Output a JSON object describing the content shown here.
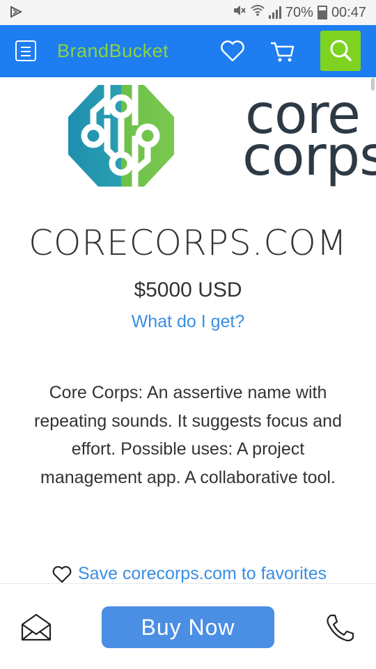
{
  "status_bar": {
    "battery": "70%",
    "time": "00:47"
  },
  "header": {
    "logo_part1": "Brand",
    "logo_part2": "Bucket"
  },
  "brand_logo": {
    "line1": "core",
    "line2": "corps"
  },
  "domain": {
    "name": "CORECORPS.COM",
    "price": "$5000 USD",
    "what_link": "What do I get?",
    "description": "Core Corps: An assertive name with repeating sounds. It suggests focus and effort. Possible uses: A project management app. A collaborative tool."
  },
  "favorites": {
    "label": "Save corecorps.com to favorites"
  },
  "bottom_bar": {
    "buy_label": "Buy Now"
  },
  "colors": {
    "app_bar": "#1e7df0",
    "search_bg": "#7ed321",
    "link": "#3a8ee0",
    "buy_button": "#4a8fe4"
  }
}
